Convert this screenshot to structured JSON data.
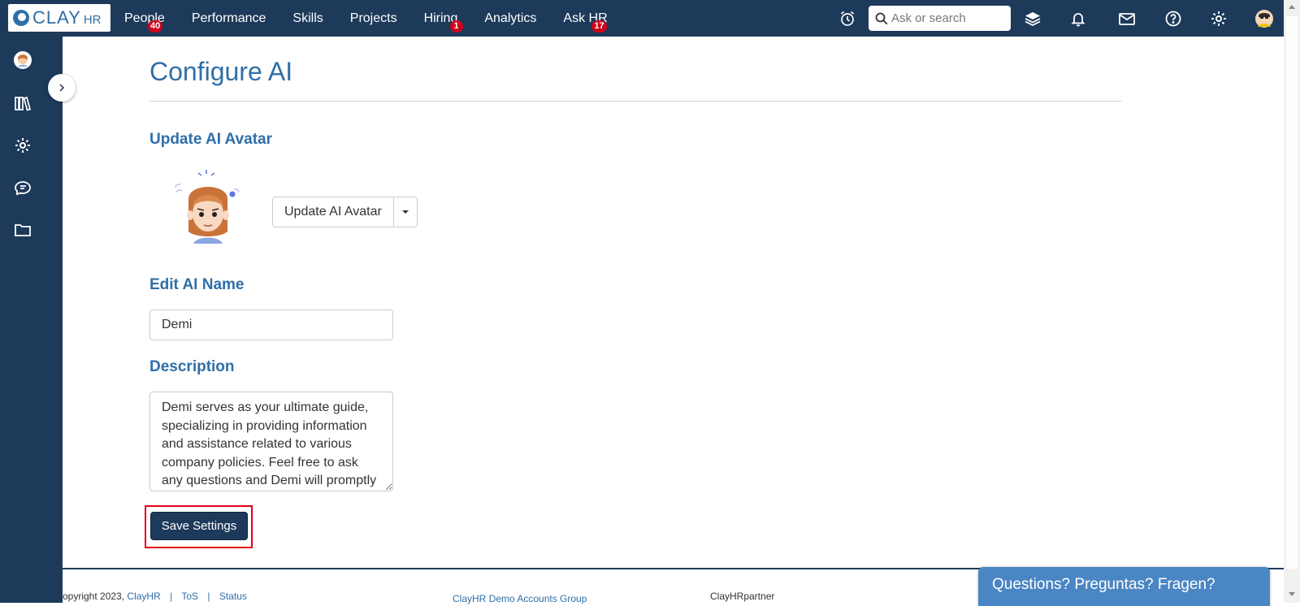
{
  "brand": {
    "logo_main": "CLAY",
    "logo_sub": "HR"
  },
  "nav": {
    "items": [
      {
        "label": "People",
        "badge": "40"
      },
      {
        "label": "Performance",
        "badge": ""
      },
      {
        "label": "Skills",
        "badge": ""
      },
      {
        "label": "Projects",
        "badge": ""
      },
      {
        "label": "Hiring",
        "badge": "1"
      },
      {
        "label": "Analytics",
        "badge": ""
      },
      {
        "label": "Ask HR",
        "badge": "17"
      }
    ]
  },
  "search": {
    "placeholder": "Ask or search",
    "icon": "search-icon"
  },
  "header_icons": [
    "alarm-clock-icon",
    "layers-icon",
    "bell-icon",
    "mail-icon",
    "help-icon",
    "gear-icon",
    "user-avatar"
  ],
  "sidebar": {
    "items": [
      "profile-avatar",
      "library-icon",
      "gear-icon",
      "chat-icon",
      "folder-icon"
    ],
    "collapse_icon": "chevron-right-icon"
  },
  "page": {
    "title": "Configure AI",
    "avatar_section": {
      "heading": "Update AI Avatar",
      "button_label": "Update AI Avatar"
    },
    "name_section": {
      "heading": "Edit AI Name",
      "value": "Demi"
    },
    "description_section": {
      "heading": "Description",
      "value": "Demi serves as your ultimate guide, specializing in providing information and assistance related to various company policies. Feel free to ask any questions and Demi will promptly"
    },
    "save_label": "Save Settings"
  },
  "footer": {
    "copyright": "opyright 2023,",
    "brand_link": "ClayHR",
    "sep": "|",
    "tos": "ToS",
    "status": "Status",
    "group": "ClayHR Demo Accounts Group",
    "partner": "ClayHRpartner"
  },
  "chat_widget": {
    "label": "Questions? Preguntas? Fragen?"
  },
  "colors": {
    "nav_bg": "#1d3a5b",
    "accent": "#2f6fa8",
    "badge": "#d0021b",
    "highlight": "#e2001a",
    "chat": "#4b86c4"
  }
}
